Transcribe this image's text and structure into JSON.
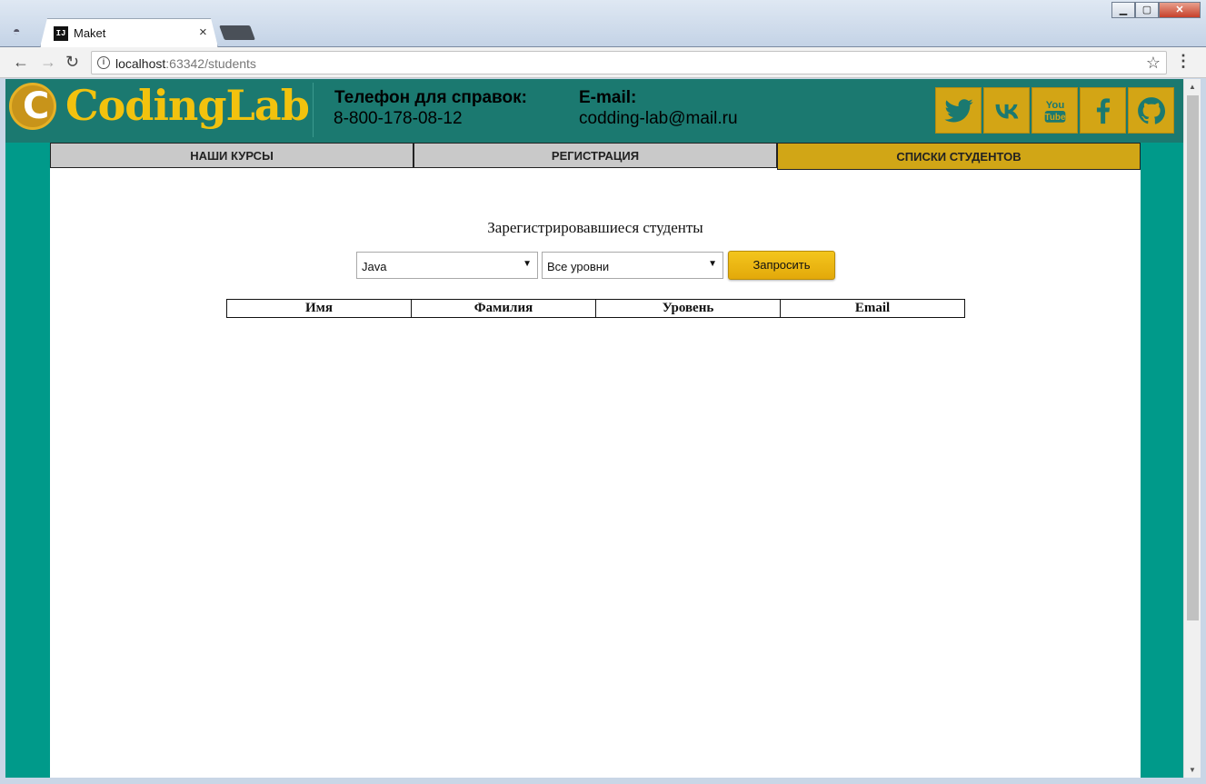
{
  "browser": {
    "tab_title": "Maket",
    "tab_favicon": "IJ",
    "url_host": "localhost",
    "url_rest": ":63342/students"
  },
  "header": {
    "logo_letter": "C",
    "logo_text": "CodingLab",
    "phone_label": "Телефон для справок:",
    "phone_value": "8-800-178-08-12",
    "email_label": "E-mail:",
    "email_value": "codding-lab@mail.ru",
    "social_icons": [
      "twitter-icon",
      "vk-icon",
      "youtube-icon",
      "facebook-icon",
      "github-icon"
    ]
  },
  "nav": {
    "tabs": [
      {
        "label": "Наши курсы"
      },
      {
        "label": "Регистрация"
      },
      {
        "label": "Списки студентов"
      }
    ],
    "active": "Списки студентов"
  },
  "main": {
    "title": "Зарегистрировавшиеся студенты",
    "course_select": "Java",
    "level_select": "Все уровни",
    "request_button": "Запросить",
    "table_headers": [
      "Имя",
      "Фамилия",
      "Уровень",
      "Email"
    ]
  },
  "colors": {
    "accent": "#d1a616",
    "header_bg": "#1b7970",
    "page_bg": "#009a8a"
  }
}
